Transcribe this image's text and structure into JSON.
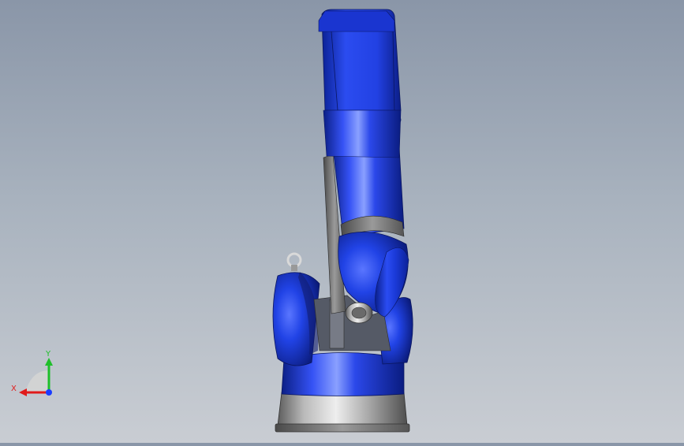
{
  "viewport": {
    "background_top": "#8a96a8",
    "background_bottom": "#c9cdd3",
    "model": "robot-arm",
    "model_color": "#1f3fd6",
    "base_metal_color": "#b8b8b8"
  },
  "triad": {
    "x_label": "X",
    "y_label": "Y",
    "x_color": "#e01b1b",
    "y_color": "#1fbf2a",
    "z_color": "#1a3cff"
  }
}
